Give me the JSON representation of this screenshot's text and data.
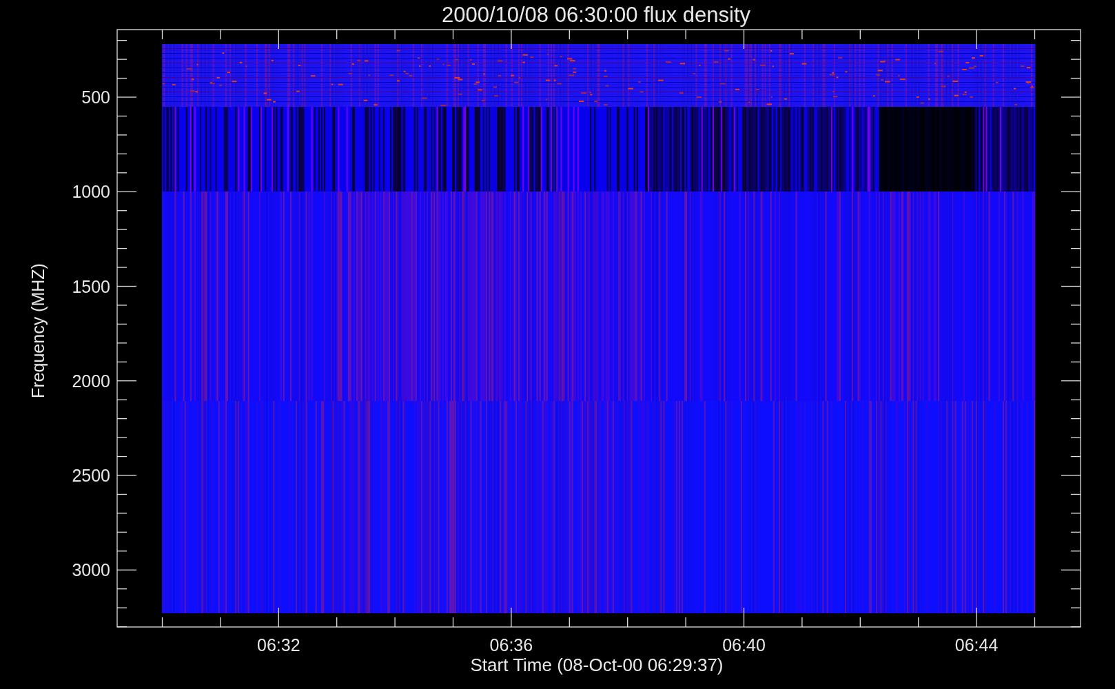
{
  "plot": {
    "title": "2000/10/08 06:30:00 flux density",
    "xlabel": "Start Time (08-Oct-00 06:29:37)",
    "ylabel": "Frequency (MHZ)",
    "xticks": [
      "06:32",
      "06:36",
      "06:40",
      "06:44"
    ],
    "yticks": [
      "500",
      "1000",
      "1500",
      "2000",
      "2500",
      "3000"
    ]
  }
}
